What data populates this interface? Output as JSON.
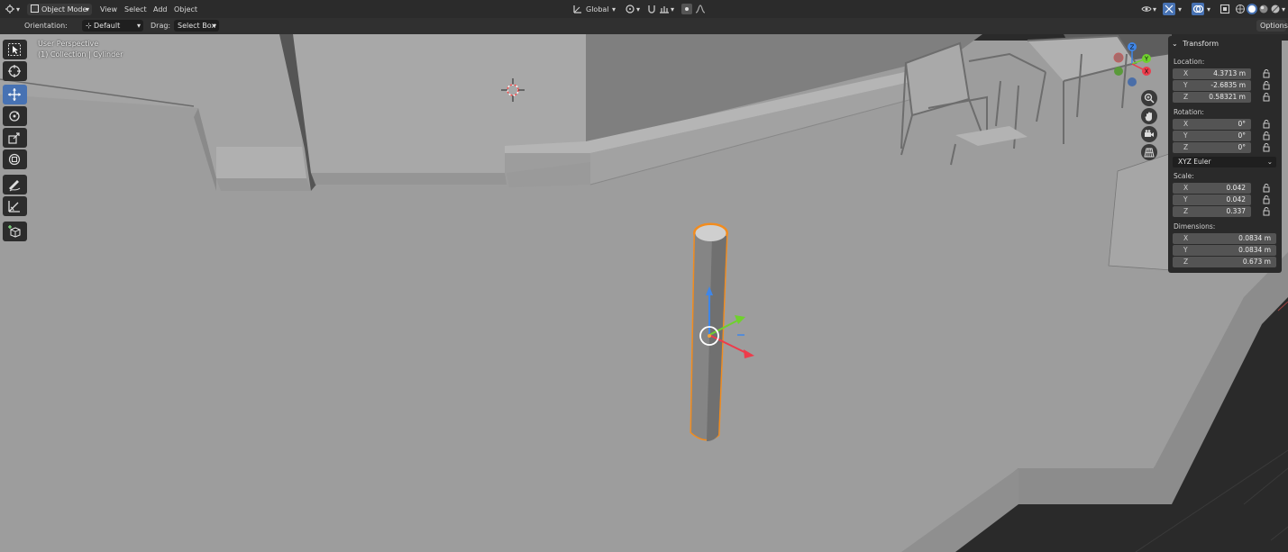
{
  "header": {
    "mode_label": "Object Mode",
    "menu": [
      "View",
      "Select",
      "Add",
      "Object"
    ],
    "transform_orientation": "Global"
  },
  "subheader": {
    "orientation_label": "Orientation:",
    "orientation_value": "Default",
    "drag_label": "Drag:",
    "drag_value": "Select Box",
    "options_label": "Options"
  },
  "viewport": {
    "perspective": "User Perspective",
    "selection": "(1) Collection | Cylinder",
    "selection_outline_color": "#f28c1e"
  },
  "gizmo": {
    "x_label": "X",
    "y_label": "Y",
    "z_label": "Z"
  },
  "transform_panel": {
    "title": "Transform",
    "location_label": "Location:",
    "location": [
      {
        "axis": "X",
        "value": "4.3713 m"
      },
      {
        "axis": "Y",
        "value": "-2.6835 m"
      },
      {
        "axis": "Z",
        "value": "0.58321 m"
      }
    ],
    "rotation_label": "Rotation:",
    "rotation": [
      {
        "axis": "X",
        "value": "0°"
      },
      {
        "axis": "Y",
        "value": "0°"
      },
      {
        "axis": "Z",
        "value": "0°"
      }
    ],
    "rotation_mode": "XYZ Euler",
    "scale_label": "Scale:",
    "scale": [
      {
        "axis": "X",
        "value": "0.042"
      },
      {
        "axis": "Y",
        "value": "0.042"
      },
      {
        "axis": "Z",
        "value": "0.337"
      }
    ],
    "dimensions_label": "Dimensions:",
    "dimensions": [
      {
        "axis": "X",
        "value": "0.0834 m"
      },
      {
        "axis": "Y",
        "value": "0.0834 m"
      },
      {
        "axis": "Z",
        "value": "0.673 m"
      }
    ]
  },
  "toolbar": {
    "tools": [
      "select-box-tool",
      "cursor-tool",
      "move-tool",
      "rotate-tool",
      "scale-tool",
      "transform-tool",
      "annotate-tool",
      "measure-tool",
      "add-cube-tool"
    ],
    "active_tool": "move-tool"
  }
}
